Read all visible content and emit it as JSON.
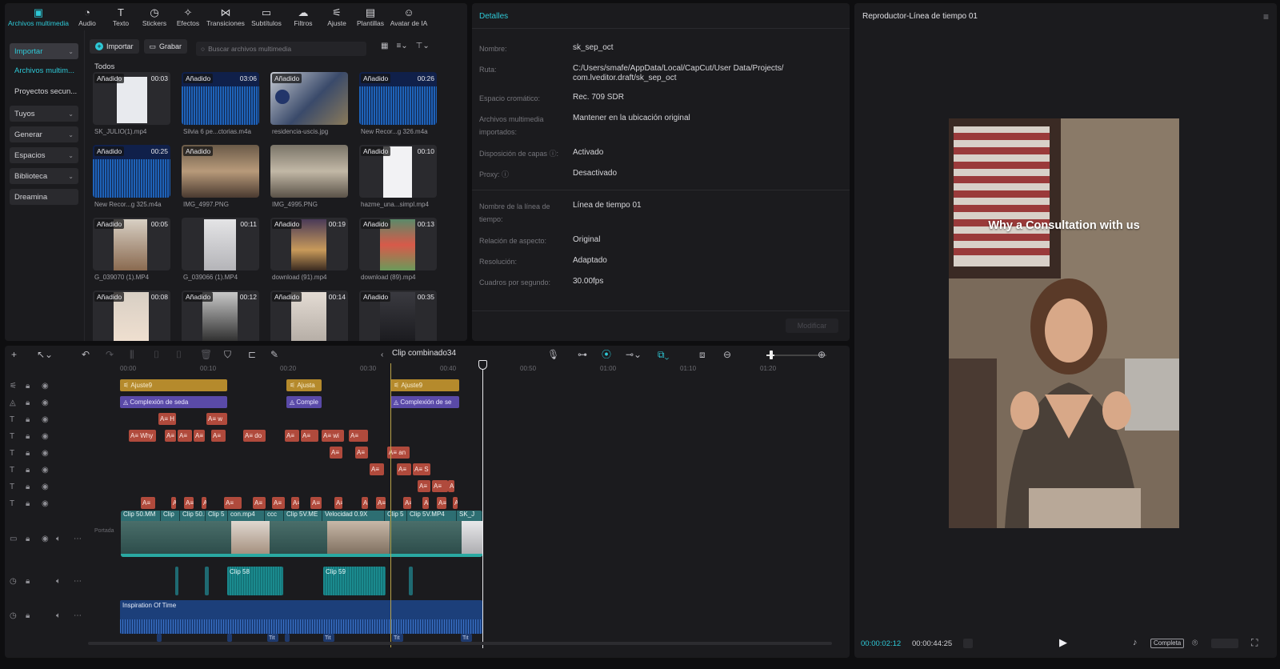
{
  "toolbar": {
    "items": [
      {
        "label": "Archivos multimedia",
        "icon": "media-icon"
      },
      {
        "label": "Audio",
        "icon": "audio-icon"
      },
      {
        "label": "Texto",
        "icon": "text-icon"
      },
      {
        "label": "Stickers",
        "icon": "sticker-icon"
      },
      {
        "label": "Efectos",
        "icon": "effects-icon"
      },
      {
        "label": "Transiciones",
        "icon": "transition-icon"
      },
      {
        "label": "Subtítulos",
        "icon": "subtitles-icon"
      },
      {
        "label": "Filtros",
        "icon": "filter-icon"
      },
      {
        "label": "Ajuste",
        "icon": "adjust-icon"
      },
      {
        "label": "Plantillas",
        "icon": "templates-icon"
      },
      {
        "label": "Avatar de IA",
        "icon": "ai-avatar-icon"
      }
    ]
  },
  "sidebar": {
    "import_label": "Importar",
    "media_label": "Archivos multim...",
    "projects_label": "Proyectos secun...",
    "tuyos_label": "Tuyos",
    "generar_label": "Generar",
    "espacios_label": "Espacios",
    "biblioteca_label": "Biblioteca",
    "dreamina_label": "Dreamina"
  },
  "media": {
    "import_button": "Importar",
    "record_button": "Grabar",
    "search_placeholder": "Buscar archivos multimedia",
    "filter_label": "Todos",
    "badge": "Añadido",
    "items": [
      {
        "name": "SK_JULIO(1).mp4",
        "duration": "00:03"
      },
      {
        "name": "Silvia 6 pe...ctorias.m4a",
        "duration": "03:06"
      },
      {
        "name": "residencia-uscis.jpg",
        "duration": ""
      },
      {
        "name": "New Recor...g 326.m4a",
        "duration": "00:26"
      },
      {
        "name": "New Recor...g 325.m4a",
        "duration": "00:25"
      },
      {
        "name": "IMG_4997.PNG",
        "duration": ""
      },
      {
        "name": "IMG_4995.PNG",
        "duration": ""
      },
      {
        "name": "hazme_una...simpl.mp4",
        "duration": "00:10"
      },
      {
        "name": "G_039070 (1).MP4",
        "duration": "00:05"
      },
      {
        "name": "G_039066 (1).MP4",
        "duration": "00:11"
      },
      {
        "name": "download (91).mp4",
        "duration": "00:19"
      },
      {
        "name": "download (89).mp4",
        "duration": "00:13"
      },
      {
        "name": "",
        "duration": "00:08"
      },
      {
        "name": "",
        "duration": "00:12"
      },
      {
        "name": "",
        "duration": "00:14"
      },
      {
        "name": "",
        "duration": "00:35"
      }
    ]
  },
  "details": {
    "title": "Detalles",
    "rows": [
      {
        "label": "Nombre:",
        "value": "sk_sep_oct"
      },
      {
        "label": "Ruta:",
        "value": "C:/Users/smafe/AppData/Local/CapCut/User Data/Projects/",
        "value2": "com.lveditor.draft/sk_sep_oct"
      },
      {
        "label": "Espacio cromático:",
        "value": "Rec. 709 SDR"
      },
      {
        "label": "Archivos multimedia importados:",
        "value": "Mantener en la ubicación original"
      },
      {
        "label": "Disposición de capas ⓘ:",
        "value": "Activado"
      },
      {
        "label": "Proxy: ⓘ",
        "value": "Desactivado"
      },
      {
        "label": "Nombre de la línea de tiempo:",
        "value": "Línea de tiempo 01"
      },
      {
        "label": "Relación de aspecto:",
        "value": "Original"
      },
      {
        "label": "Resolución:",
        "value": "Adaptado"
      },
      {
        "label": "Cuadros por segundo:",
        "value": "30.00fps"
      }
    ],
    "modify_button": "Modificar"
  },
  "player": {
    "title": "Reproductor-Línea de tiempo 01",
    "overlay_text": "Why a Consultation with us",
    "current_time": "00:00:02:12",
    "total_time": "00:00:44:25",
    "fit_label": "Completa"
  },
  "timeline": {
    "clip_title": "Clip combinado34",
    "ruler": [
      "00:00",
      "00:10",
      "00:20",
      "00:30",
      "00:40",
      "00:50",
      "01:00",
      "01:10",
      "01:20"
    ],
    "adjust_label": "Ajuste9",
    "adjust_short": "Ajusta",
    "effect_label": "Complexión de seda",
    "effect_short": "Comple",
    "effect_label2": "Complexión de se",
    "text_glyph": "A≡",
    "text_clips": [
      "A≡ H",
      "A≡ w",
      "A≡ Why",
      "A≡ do",
      "A≡ wi",
      "A≡ w",
      "A≡ an",
      "A≡ S"
    ],
    "video_labels": [
      "Clip 50.MM",
      "Clip",
      "Clip 50.I",
      "Clip 5",
      "con.mp4",
      "ccc",
      "Clip 5V.ME",
      "Velocidad 0.9X",
      "Clip 5",
      "Clip 5V.MP4",
      "SK_J"
    ],
    "audio_clips": [
      "Clip 58",
      "Clip 59"
    ],
    "music_label": "Inspiration Of Time",
    "cover_label": "Portada",
    "title_marker": "Tit"
  }
}
